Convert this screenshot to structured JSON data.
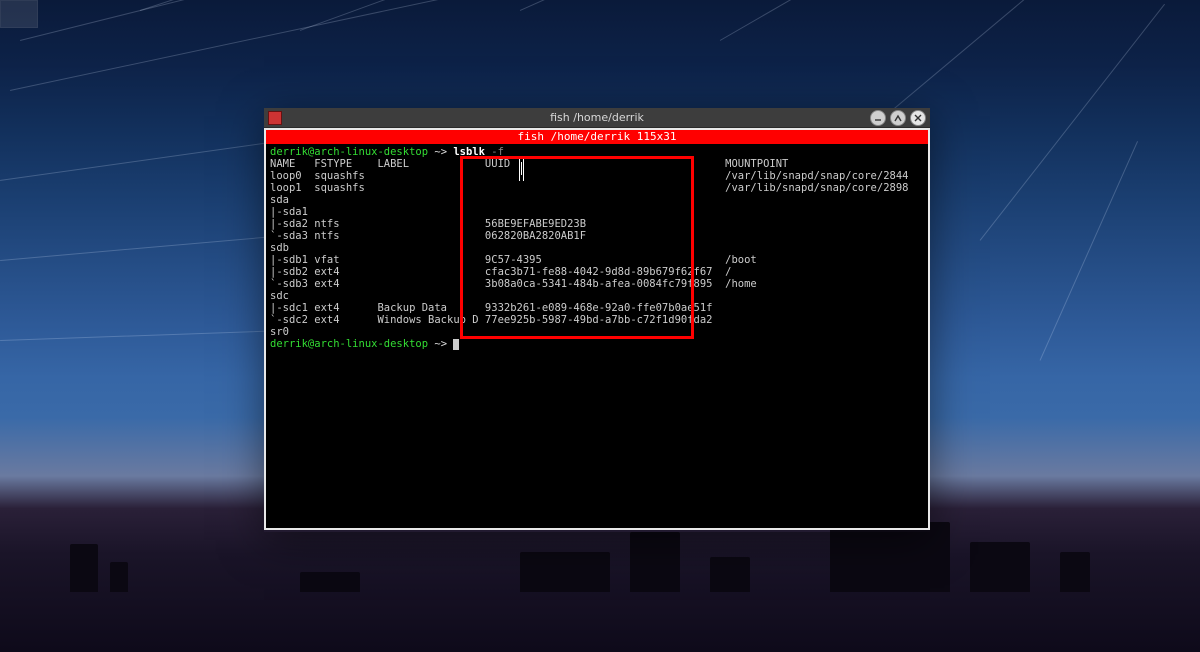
{
  "window": {
    "titlebar_text": "fish /home/derrik",
    "banner_text": "fish /home/derrik 115x31"
  },
  "prompt": {
    "user_host": "derrik@arch-linux-desktop",
    "separator": " ~> ",
    "command": "lsblk",
    "command_args": " -f"
  },
  "headers": {
    "name": "NAME",
    "fstype": "FSTYPE",
    "label": "LABEL",
    "uuid": "UUID",
    "mountpoint": "MOUNTPOINT"
  },
  "rows": [
    {
      "name": "loop0",
      "fstype": "squashfs",
      "label": "",
      "uuid": "",
      "mountpoint": "/var/lib/snapd/snap/core/2844"
    },
    {
      "name": "loop1",
      "fstype": "squashfs",
      "label": "",
      "uuid": "",
      "mountpoint": "/var/lib/snapd/snap/core/2898"
    },
    {
      "name": "sda",
      "fstype": "",
      "label": "",
      "uuid": "",
      "mountpoint": ""
    },
    {
      "name": "|-sda1",
      "fstype": "",
      "label": "",
      "uuid": "",
      "mountpoint": ""
    },
    {
      "name": "|-sda2",
      "fstype": "ntfs",
      "label": "",
      "uuid": "56BE9EFABE9ED23B",
      "mountpoint": ""
    },
    {
      "name": "`-sda3",
      "fstype": "ntfs",
      "label": "",
      "uuid": "062820BA2820AB1F",
      "mountpoint": ""
    },
    {
      "name": "sdb",
      "fstype": "",
      "label": "",
      "uuid": "",
      "mountpoint": ""
    },
    {
      "name": "|-sdb1",
      "fstype": "vfat",
      "label": "",
      "uuid": "9C57-4395",
      "mountpoint": "/boot"
    },
    {
      "name": "|-sdb2",
      "fstype": "ext4",
      "label": "",
      "uuid": "cfac3b71-fe88-4042-9d8d-89b679f62f67",
      "mountpoint": "/"
    },
    {
      "name": "`-sdb3",
      "fstype": "ext4",
      "label": "",
      "uuid": "3b08a0ca-5341-484b-afea-0084fc79f895",
      "mountpoint": "/home"
    },
    {
      "name": "sdc",
      "fstype": "",
      "label": "",
      "uuid": "",
      "mountpoint": ""
    },
    {
      "name": "|-sdc1",
      "fstype": "ext4",
      "label": "Backup Data",
      "uuid": "9332b261-e089-468e-92a0-ffe07b0ae51f",
      "mountpoint": ""
    },
    {
      "name": "`-sdc2",
      "fstype": "ext4",
      "label": "Windows Backup D",
      "uuid": "77ee925b-5987-49bd-a7bb-c72f1d90fda2",
      "mountpoint": ""
    },
    {
      "name": "sr0",
      "fstype": "",
      "label": "",
      "uuid": "",
      "mountpoint": ""
    }
  ],
  "prompt2": {
    "user_host": "derrik@arch-linux-desktop",
    "separator": " ~> "
  },
  "column_widths": {
    "name": 6,
    "fstype": 9,
    "label": 16,
    "uuid": 37
  }
}
